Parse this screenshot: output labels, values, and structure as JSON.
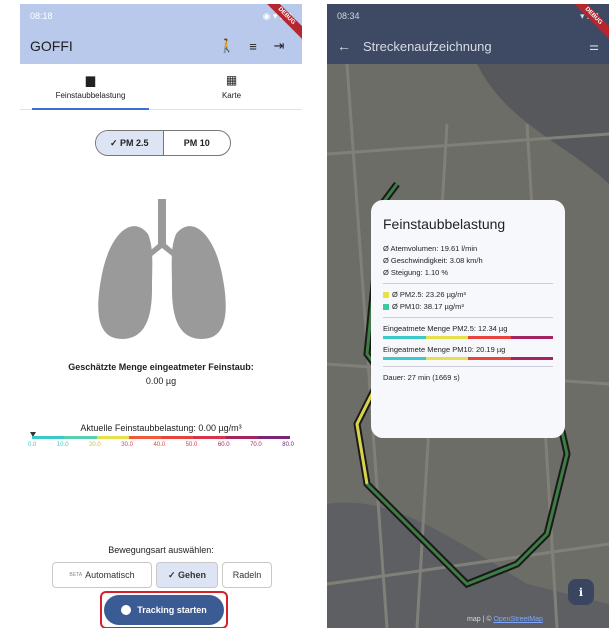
{
  "left": {
    "status_time": "08:18",
    "title": "GOFFI",
    "tabs": [
      {
        "label": "Feinstaubbelastung",
        "icon": "chart-icon"
      },
      {
        "label": "Karte",
        "icon": "map-icon"
      }
    ],
    "pm_toggle": {
      "pm25": "PM 2.5",
      "pm10": "PM 10"
    },
    "estimated": {
      "label": "Geschätzte Menge eingeatmeter Feinstaub:",
      "value": "0.00 µg"
    },
    "current": {
      "label": "Aktuelle Feinstaubbelastung: 0.00 µg/m³"
    },
    "scale_ticks": [
      "0.0",
      "10.0",
      "20.0",
      "30.0",
      "40.0",
      "50.0",
      "60.0",
      "70.0",
      "80.0"
    ],
    "movement": {
      "label": "Bewegungsart auswählen:",
      "beta": "BETA",
      "auto": "Automatisch",
      "walk": "Gehen",
      "bike": "Radeln"
    },
    "track_button": "Tracking starten"
  },
  "right": {
    "status_time": "08:34",
    "title": "Streckenaufzeichnung",
    "card": {
      "title": "Feinstaubbelastung",
      "lines": [
        "Ø Atemvolumen: 19.61 l/min",
        "Ø Geschwindigkeit: 3.08 km/h",
        "Ø Steigung: 1.10 %"
      ],
      "pm25": "Ø PM2.5: 23.26 µg/m³",
      "pm10": "Ø PM10: 38.17 µg/m³",
      "inhaled_pm25": "Eingeatmete Menge PM2.5: 12.34 µg",
      "inhaled_pm10": "Eingeatmete Menge PM10: 20.19 µg",
      "duration": "Dauer: 27 min (1669 s)"
    },
    "attribution": "map | ©",
    "attribution_link": "OpenStreetMap"
  },
  "debug_label": "DEBUG",
  "colors": {
    "appbar_left": "#b8c9ec",
    "appbar_right": "#3e4a63",
    "primary": "#3b5b94",
    "highlight_red": "#d7202a",
    "route": "#1a1a1a"
  }
}
